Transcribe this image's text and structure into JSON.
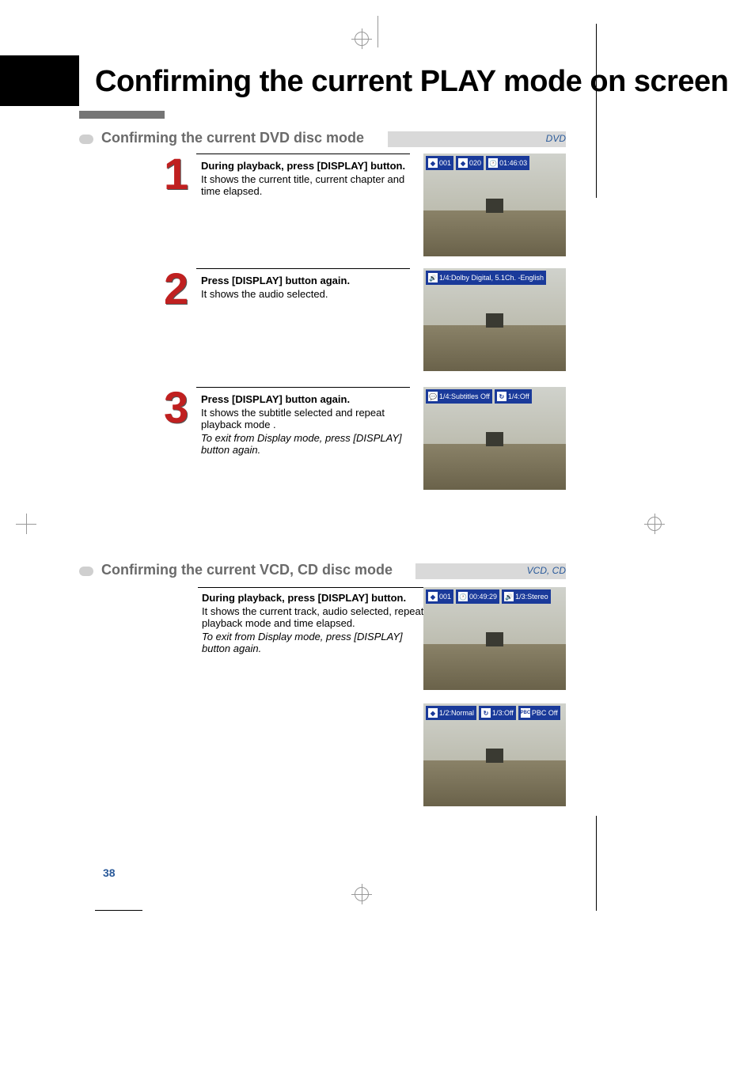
{
  "page_title": "Confirming the current PLAY mode on screen",
  "page_number": "38",
  "section1": {
    "heading": "Confirming the current DVD disc mode",
    "tag": "DVD",
    "steps": [
      {
        "num": "1",
        "head": "During playback, press [DISPLAY] button.",
        "body": "It shows the current title, current chapter and time elapsed."
      },
      {
        "num": "2",
        "head": "Press [DISPLAY] button again.",
        "body": "It shows the audio selected."
      },
      {
        "num": "3",
        "head": "Press [DISPLAY] button again.",
        "body": "It shows the subtitle selected and repeat playback mode .",
        "italic": "To exit from Display mode, press [DISPLAY] button again."
      }
    ],
    "osd": {
      "shot1": {
        "title": "001",
        "chapter": "020",
        "time": "01:46:03"
      },
      "shot2": {
        "audio": "1/4:Dolby Digital, 5.1Ch. -English"
      },
      "shot3": {
        "subtitle": "1/4:Subtitles Off",
        "repeat": "1/4:Off"
      }
    }
  },
  "section2": {
    "heading": "Confirming the current VCD, CD disc mode",
    "tag": "VCD, CD",
    "step": {
      "head": "During playback, press [DISPLAY] button.",
      "body": "It shows the current track, audio selected, repeat playback mode and time elapsed.",
      "italic": "To exit from Display mode, press [DISPLAY] button again."
    },
    "osd": {
      "shot1": {
        "track": "001",
        "time": "00:49:29",
        "audio": "1/3:Stereo"
      },
      "shot2": {
        "zoom": "1/2:Normal",
        "repeat": "1/3:Off",
        "pbc_label": "PBC",
        "pbc": "PBC Off"
      }
    }
  },
  "icons": {
    "disc": "◉",
    "clock": "🕐",
    "speaker": "🔊",
    "subtitle": "💬",
    "repeat": "↻"
  }
}
